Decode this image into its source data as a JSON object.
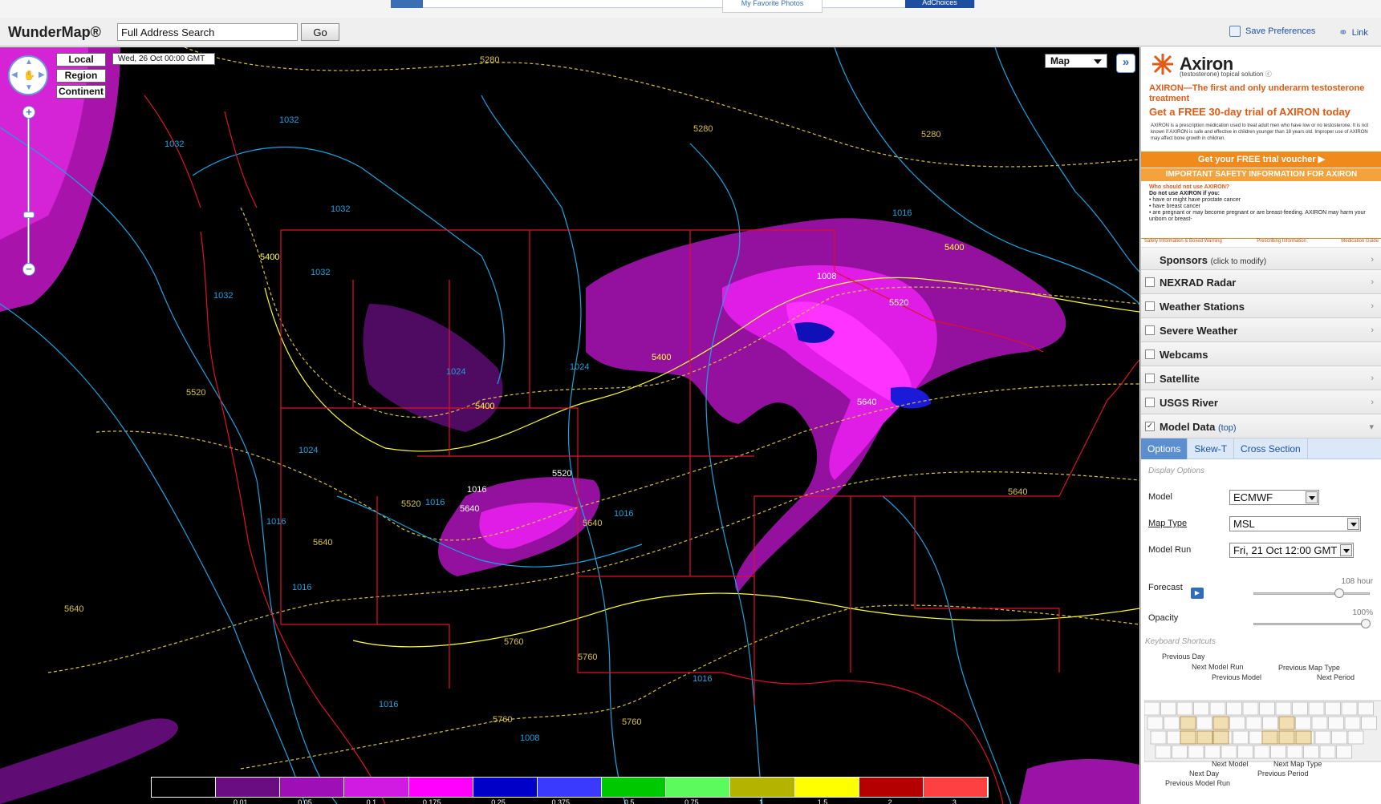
{
  "ad_strip": {
    "favorite_photos": "My Favorite Photos",
    "adchoices": "AdChoices"
  },
  "header": {
    "brand": "WunderMap®",
    "search_value": "Full Address Search",
    "go_label": "Go",
    "save_prefs_label": "Save Preferences",
    "link_label": "Link"
  },
  "map": {
    "scale_buttons": [
      "Local",
      "Region",
      "Continent"
    ],
    "date_label": "Wed, 26 Oct 00:00 GMT",
    "map_type": "Map",
    "contour_labels": [
      "5280",
      "5280",
      "5280",
      "5400",
      "5400",
      "5400",
      "5400",
      "5520",
      "5520",
      "5520",
      "5520",
      "5640",
      "5640",
      "5640",
      "5640",
      "5640",
      "5640",
      "5760",
      "5760",
      "5760",
      "5760",
      "1032",
      "1032",
      "1032",
      "1032",
      "1032",
      "1024",
      "1024",
      "1024",
      "1016",
      "1016",
      "1016",
      "1016",
      "1016",
      "1016",
      "1016",
      "1016",
      "1008",
      "1008"
    ],
    "legend_colors": [
      "#000000",
      "#6a0d82",
      "#9e0fb6",
      "#d21be2",
      "#ff00ff",
      "#0000c8",
      "#3a3aff",
      "#00c800",
      "#5dfa5d",
      "#b4b400",
      "#ffff00",
      "#b40000",
      "#ff4040"
    ],
    "legend_labels": [
      "0.01",
      "0.05",
      "0.1",
      "0.175",
      "0.25",
      "0.375",
      "0.5",
      "0.75",
      "1",
      "1.5",
      "2",
      "3"
    ]
  },
  "panel": {
    "ad": {
      "brand": "Axiron",
      "sub": "(testosterone) topical solution ⓒ",
      "headline": "AXIRON—The first and only underarm testosterone treatment",
      "headline2": "Get a FREE 30-day trial of AXIRON today",
      "fine": "AXIRON is a prescription medication used to treat adult men who have low or no testosterone. It is not known if AXIRON is safe and effective in children younger than 18 years old. Improper use of AXIRON may affect bone growth in children.",
      "cta": "Get your FREE trial voucher ▶",
      "safety": "IMPORTANT SAFETY INFORMATION FOR AXIRON",
      "warn_q": "Who should not use AXIRON?",
      "warn_1": "Do not use AXIRON if you:",
      "warn_2": "• have or might have prostate cancer",
      "warn_3": "• have breast cancer",
      "warn_4": "• are pregnant or may become pregnant or are breast-feeding. AXIRON may harm your unborn or breast-",
      "link_1": "Safety Information & Boxed Warning",
      "link_2": "Prescribing Information",
      "link_3": "Medication Guide"
    },
    "sponsors_label": "Sponsors",
    "sponsors_hint": "(click to modify)",
    "layers": [
      "NEXRAD Radar",
      "Weather Stations",
      "Severe Weather",
      "Webcams",
      "Satellite",
      "USGS River"
    ],
    "model_data_label": "Model Data",
    "model_data_top": "(top)",
    "tabs": [
      "Options",
      "Skew-T",
      "Cross Section"
    ],
    "display_options": "Display Options",
    "model_label": "Model",
    "model_value": "ECMWF",
    "map_type_label": "Map Type",
    "map_type_value": "MSL",
    "model_run_label": "Model Run",
    "model_run_value": "Fri, 21 Oct 12:00 GMT",
    "forecast_label": "Forecast",
    "forecast_value": "108 hour",
    "forecast_level": 0.75,
    "opacity_label": "Opacity",
    "opacity_value": "100%",
    "opacity_level": 1.0,
    "shortcuts_title": "Keyboard Shortcuts",
    "shortcuts": {
      "prev_day": "Previous Day",
      "next_run": "Next Model Run",
      "prev_model": "Previous Model",
      "prev_map_type": "Previous Map Type",
      "next_period": "Next Period",
      "next_model": "Next Model",
      "next_map_type": "Next Map Type",
      "next_day": "Next Day",
      "prev_period": "Previous Period",
      "prev_run": "Previous Model Run"
    }
  }
}
